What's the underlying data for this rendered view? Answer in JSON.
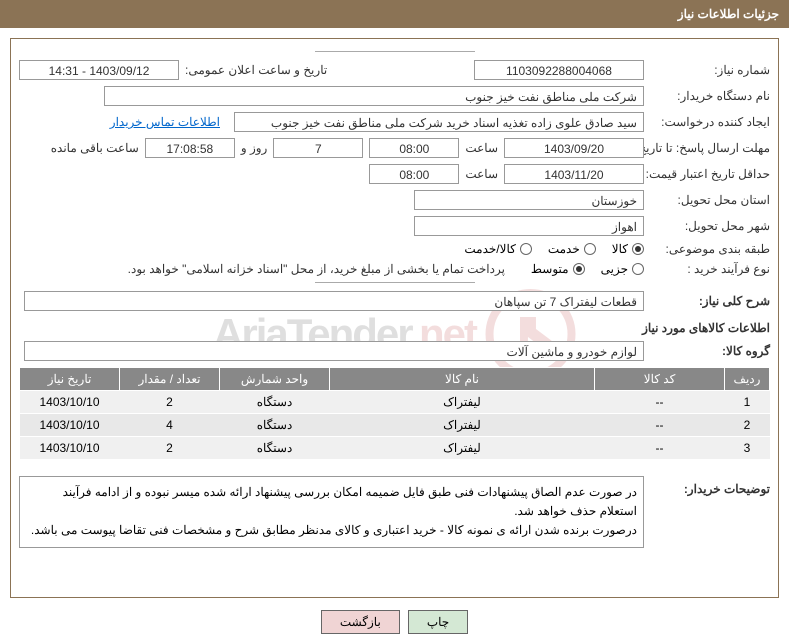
{
  "header": {
    "title": "جزئیات اطلاعات نیاز"
  },
  "fields": {
    "need_no_label": "شماره نیاز:",
    "need_no": "1103092288004068",
    "announce_label": "تاریخ و ساعت اعلان عمومی:",
    "announce_value": "1403/09/12 - 14:31",
    "buyer_label": "نام دستگاه خریدار:",
    "buyer_value": "شرکت ملی مناطق نفت خیز جنوب",
    "creator_label": "ایجاد کننده درخواست:",
    "creator_value": "سید صادق علوی زاده  تغذیه اسناد خرید  شرکت ملی مناطق نفت خیز جنوب",
    "contact_link": "اطلاعات تماس خریدار",
    "deadline_label": "مهلت ارسال پاسخ: تا تاریخ:",
    "deadline_date": "1403/09/20",
    "hour_label": "ساعت",
    "deadline_hour": "08:00",
    "days_label": "روز و",
    "days_value": "7",
    "remaining_label": "ساعت باقی مانده",
    "remaining_time": "17:08:58",
    "validity_label": "حداقل تاریخ اعتبار قیمت: تا تاریخ:",
    "validity_date": "1403/11/20",
    "validity_hour": "08:00",
    "province_label": "استان محل تحویل:",
    "province_value": "خوزستان",
    "city_label": "شهر محل تحویل:",
    "city_value": "اهواز",
    "category_label": "طبقه بندی موضوعی:",
    "process_label": "نوع فرآیند خرید :",
    "process_note": "پرداخت تمام یا بخشی از مبلغ خرید، از محل \"اسناد خزانه اسلامی\" خواهد بود.",
    "summary_label": "شرح کلی نیاز:",
    "summary_value": "قطعات لیفتراک 7 تن سپاهان",
    "goods_info_title": "اطلاعات کالاهای مورد نیاز",
    "group_label": "گروه کالا:",
    "group_value": "لوازم خودرو و ماشین آلات",
    "buyer_notes_label": "توضیحات خریدار:",
    "buyer_notes": "در صورت عدم الصاق پیشنهادات فنی طبق فایل ضمیمه امکان بررسی پیشنهاد ارائه شده میسر نبوده و از ادامه فرآیند استعلام حذف خواهد شد.\nدرصورت برنده شدن ارائه ی نمونه کالا - خرید اعتباری و کالای مدنظر مطابق شرح و مشخصات فنی تقاضا پیوست می باشد."
  },
  "radios": {
    "category": [
      {
        "label": "کالا",
        "checked": true
      },
      {
        "label": "خدمت",
        "checked": false
      },
      {
        "label": "کالا/خدمت",
        "checked": false
      }
    ],
    "process": [
      {
        "label": "جزیی",
        "checked": false
      },
      {
        "label": "متوسط",
        "checked": true
      }
    ]
  },
  "table": {
    "headers": [
      "ردیف",
      "کد کالا",
      "نام کالا",
      "واحد شمارش",
      "تعداد / مقدار",
      "تاریخ نیاز"
    ],
    "rows": [
      {
        "n": "1",
        "code": "--",
        "name": "لیفتراک",
        "unit": "دستگاه",
        "qty": "2",
        "date": "1403/10/10"
      },
      {
        "n": "2",
        "code": "--",
        "name": "لیفتراک",
        "unit": "دستگاه",
        "qty": "4",
        "date": "1403/10/10"
      },
      {
        "n": "3",
        "code": "--",
        "name": "لیفتراک",
        "unit": "دستگاه",
        "qty": "2",
        "date": "1403/10/10"
      }
    ]
  },
  "buttons": {
    "print": "چاپ",
    "back": "بازگشت"
  },
  "watermark": {
    "text1": "AriaTender",
    "text2": ".net"
  }
}
